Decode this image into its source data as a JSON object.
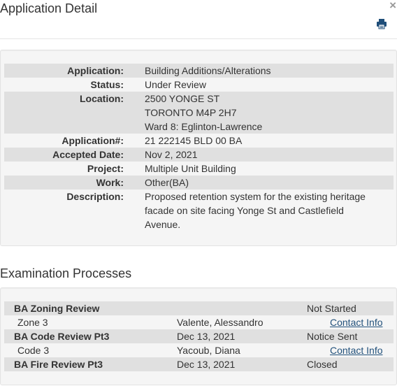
{
  "header": {
    "title": "Application Detail"
  },
  "detail": {
    "application_label": "Application:",
    "application": "Building Additions/Alterations",
    "status_label": "Status:",
    "status": "Under Review",
    "location_label": "Location:",
    "location_line1": "2500 YONGE ST",
    "location_line2": "TORONTO M4P 2H7",
    "location_line3": "Ward 8: Eglinton-Lawrence",
    "app_num_label": "Application#:",
    "app_num": "21 222145 BLD 00 BA",
    "accepted_label": "Accepted Date:",
    "accepted": "Nov 2, 2021",
    "project_label": "Project:",
    "project": "Multiple Unit Building",
    "work_label": "Work:",
    "work": "Other(BA)",
    "description_label": "Description:",
    "description_line1": "Proposed retention system for the existing heritage",
    "description_line2": "facade on site facing Yonge St and Castlefield",
    "description_line3": "Avenue."
  },
  "exam": {
    "title": "Examination Processes",
    "rows": [
      {
        "name": "BA Zoning Review",
        "date": "",
        "status": "Not Started"
      },
      {
        "sub": "Zone 3",
        "examiner": "Valente, Alessandro",
        "contact": "Contact Info"
      },
      {
        "name": "BA Code Review Pt3",
        "date": "Dec 13, 2021",
        "status": "Notice Sent"
      },
      {
        "sub": "Code 3",
        "examiner": "Yacoub, Diana",
        "contact": "Contact Info"
      },
      {
        "name": "BA Fire Review Pt3",
        "date": "Dec 13, 2021",
        "status": "Closed"
      }
    ]
  },
  "icons": {
    "close": "close-icon",
    "print": "print-icon"
  },
  "colors": {
    "link": "#23527c",
    "row_shade": "#e0e0e0",
    "panel_bg": "#f5f5f5",
    "icon": "#1f4e79"
  }
}
